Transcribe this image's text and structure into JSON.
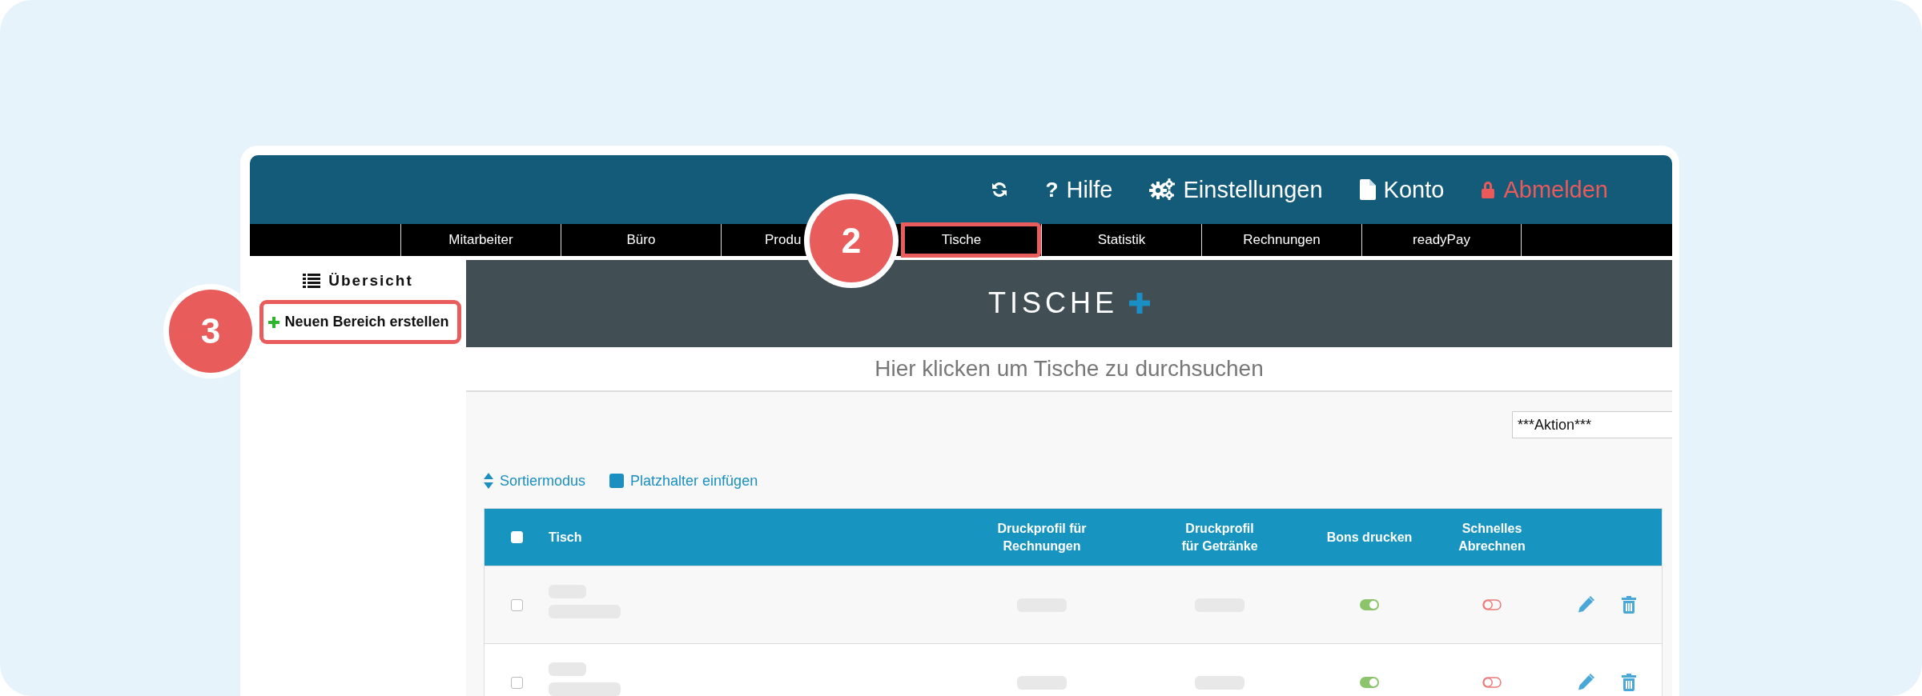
{
  "header": {
    "items": [
      {
        "kind": "refresh"
      },
      {
        "kind": "help",
        "glyph": "?",
        "label": "Hilfe"
      },
      {
        "kind": "settings",
        "label": "Einstellungen"
      },
      {
        "kind": "account",
        "label": "Konto"
      },
      {
        "kind": "logout",
        "label": "Abmelden"
      }
    ]
  },
  "tabs": [
    {
      "label": "Mitarbeiter",
      "highlighted": false,
      "clipped": false
    },
    {
      "label": "Büro",
      "highlighted": false,
      "clipped": false
    },
    {
      "label": "Produ",
      "highlighted": false,
      "clipped": true
    },
    {
      "label": "Tische",
      "highlighted": true,
      "clipped": false
    },
    {
      "label": "Statistik",
      "highlighted": false,
      "clipped": false
    },
    {
      "label": "Rechnungen",
      "highlighted": false,
      "clipped": false
    },
    {
      "label": "readyPay",
      "highlighted": false,
      "clipped": false
    }
  ],
  "sidebar": {
    "title": "Übersicht",
    "items": [
      {
        "label": "Neuen Bereich erstellen",
        "highlighted": true
      }
    ]
  },
  "banner": {
    "title": "TISCHE"
  },
  "search": {
    "placeholder": "Hier klicken um Tische zu durchsuchen"
  },
  "action_select": {
    "value": "***Aktion***"
  },
  "toolbar": [
    {
      "kind": "sort",
      "label": "Sortiermodus"
    },
    {
      "kind": "placeholder",
      "label": "Platzhalter einfügen"
    }
  ],
  "table": {
    "select_all": {
      "checked": false
    },
    "columns": [
      "Tisch",
      "Druckprofil für Rechnungen",
      "Druckprofil für Getränke",
      "Bons drucken",
      "Schnelles Abrechnen"
    ],
    "rows": [
      {
        "checked": false,
        "bons_drucken": true,
        "schnelles_abrechnen": false
      },
      {
        "checked": false,
        "bons_drucken": true,
        "schnelles_abrechnen": false
      }
    ]
  },
  "callouts": [
    {
      "label": "2"
    },
    {
      "label": "3"
    }
  ]
}
